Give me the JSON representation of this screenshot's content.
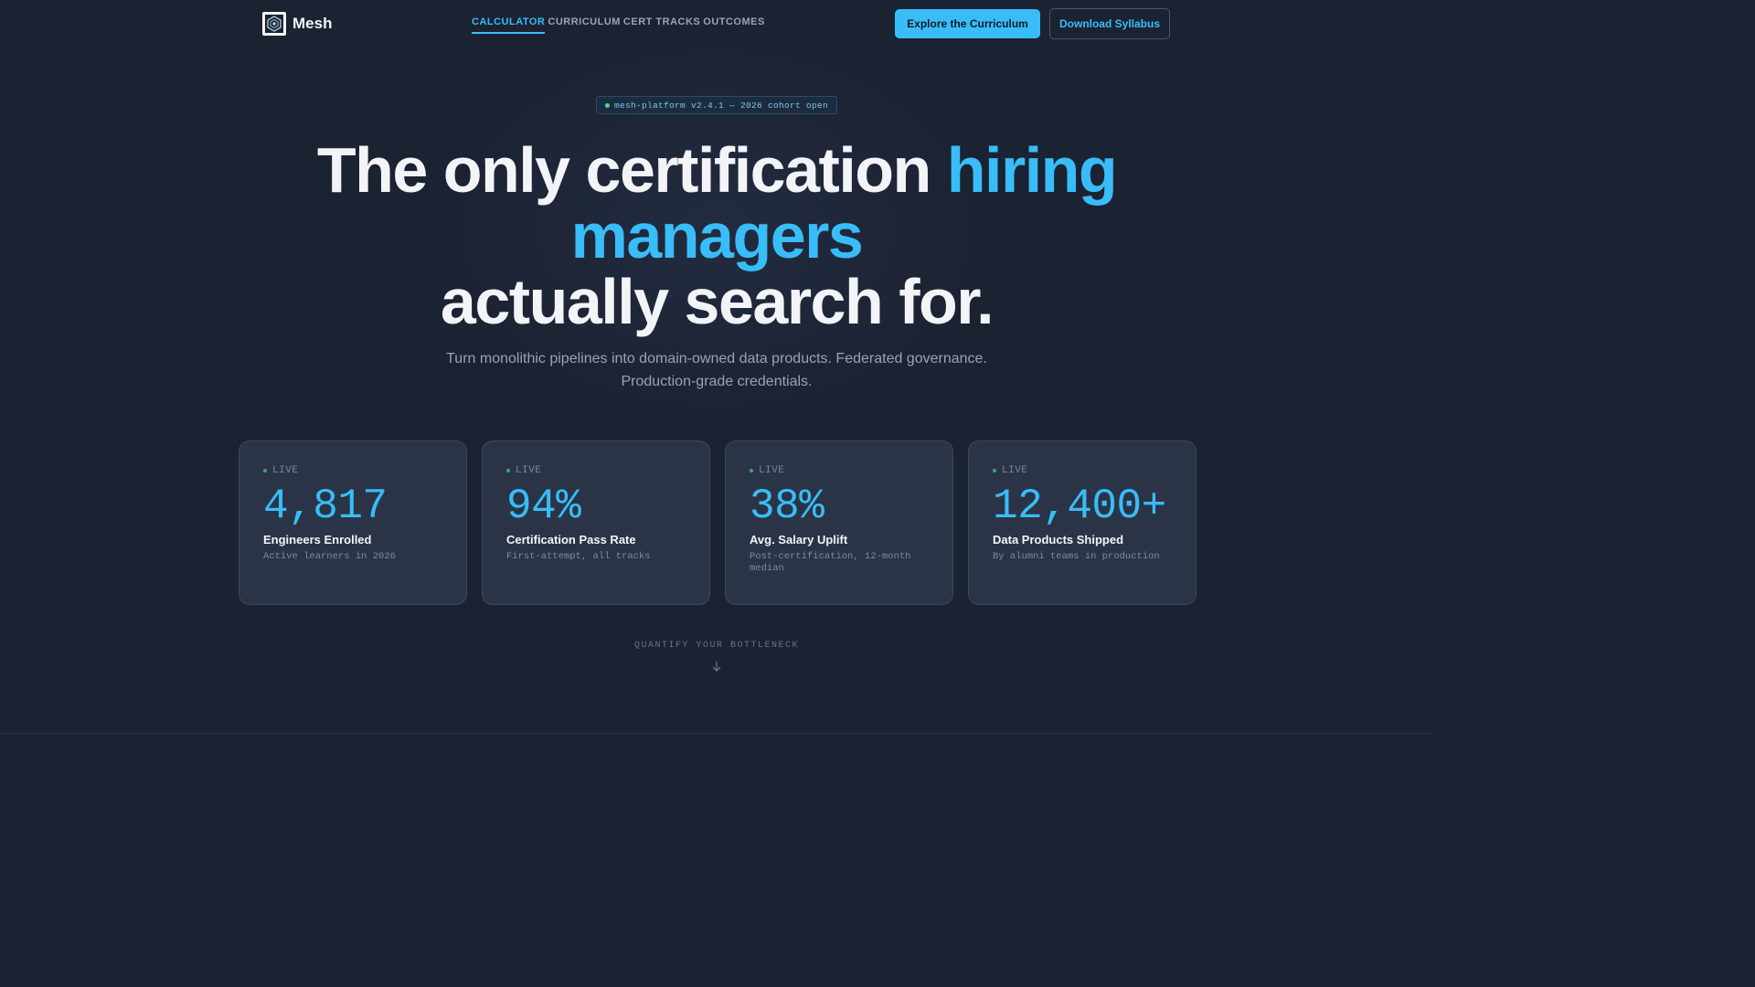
{
  "brand": {
    "name": "Mesh",
    "logo_icon": "hexagon-mesh-icon"
  },
  "nav": {
    "links": [
      {
        "label": "CALCULATOR",
        "active": true
      },
      {
        "label": "CURRICULUM",
        "active": false
      },
      {
        "label": "CERT TRACKS",
        "active": false
      },
      {
        "label": "OUTCOMES",
        "active": false
      }
    ],
    "primary_cta": "Explore the Curriculum",
    "secondary_cta": "Download Syllabus"
  },
  "hero": {
    "badge": "mesh-platform v2.4.1 — 2026 cohort open",
    "headline_part1": "The only certification ",
    "headline_highlight": "hiring managers",
    "headline_part2": "actually search for.",
    "subtitle_line1": "Turn monolithic pipelines into domain-owned data products. Federated governance.",
    "subtitle_line2": "Production-grade credentials."
  },
  "stats": [
    {
      "status": "LIVE",
      "value": "4,817",
      "label": "Engineers Enrolled",
      "desc": "Active learners in 2026"
    },
    {
      "status": "LIVE",
      "value": "94%",
      "label": "Certification Pass Rate",
      "desc": "First-attempt, all tracks"
    },
    {
      "status": "LIVE",
      "value": "38%",
      "label": "Avg. Salary Uplift",
      "desc": "Post-certification, 12-month median"
    },
    {
      "status": "LIVE",
      "value": "12,400+",
      "label": "Data Products Shipped",
      "desc": "By alumni teams in production"
    }
  ],
  "scroll_hint": {
    "label": "QUANTIFY YOUR BOTTLENECK",
    "icon": "arrow-down-icon"
  },
  "colors": {
    "accent": "#38bdf8",
    "background": "#1b2232",
    "card": "#2b3446",
    "live": "#3ea76a"
  }
}
